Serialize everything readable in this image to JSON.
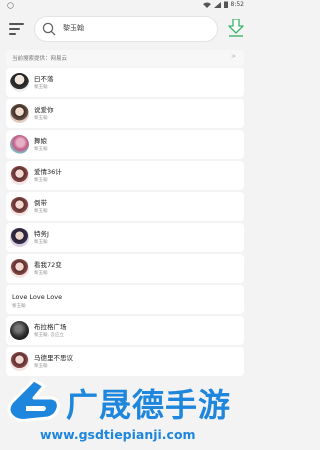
{
  "status_bar": {
    "time": "8:52"
  },
  "search": {
    "query": "黎玉翰"
  },
  "source": {
    "text": "当前搜索提供：网易云",
    "arrow": ">"
  },
  "songs": [
    {
      "title": "曰不落",
      "artist": "黎玉翰"
    },
    {
      "title": "说爱你",
      "artist": "黎玉翰"
    },
    {
      "title": "舞娘",
      "artist": "黎玉翰"
    },
    {
      "title": "爱情36计",
      "artist": "黎玉翰"
    },
    {
      "title": "倒带",
      "artist": "黎玉翰"
    },
    {
      "title": "特务J",
      "artist": "黎玉翰"
    },
    {
      "title": "看我72变",
      "artist": "黎玉翰"
    },
    {
      "title": "Love Love Love",
      "artist": "黎玉翰"
    },
    {
      "title": "布拉格广场",
      "artist": "黎玉翰, 吾应立"
    },
    {
      "title": "马德里不思议",
      "artist": "黎玉翰"
    }
  ],
  "watermark": {
    "brand": "广晟德手游",
    "url": "www.gsdtiepianji.com"
  }
}
